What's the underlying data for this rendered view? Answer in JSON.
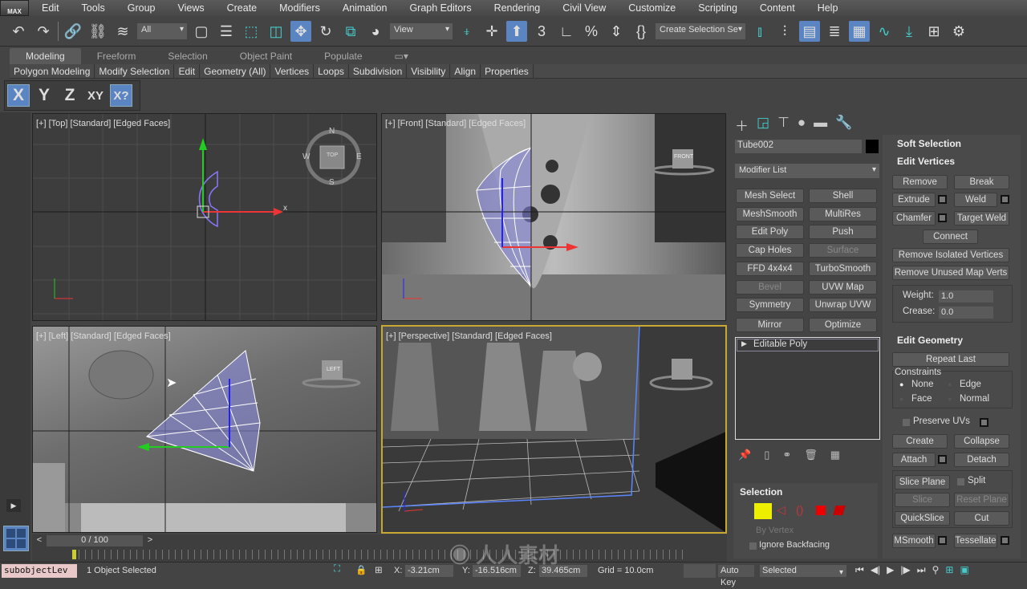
{
  "app": {
    "logo": "MAX"
  },
  "menu": [
    "Edit",
    "Tools",
    "Group",
    "Views",
    "Create",
    "Modifiers",
    "Animation",
    "Graph Editors",
    "Rendering",
    "Civil View",
    "Customize",
    "Scripting",
    "Content",
    "Help"
  ],
  "toolbar": {
    "filter": "All",
    "refcoord": "View",
    "selection_set": "Create Selection Se"
  },
  "ribbon": {
    "tabs": [
      "Modeling",
      "Freeform",
      "Selection",
      "Object Paint",
      "Populate"
    ],
    "active_tab": "Modeling",
    "panels": [
      "Polygon Modeling",
      "Modify Selection",
      "Edit",
      "Geometry (All)",
      "Vertices",
      "Loops",
      "Subdivision",
      "Visibility",
      "Align",
      "Properties"
    ]
  },
  "axis": {
    "x": "X",
    "y": "Y",
    "z": "Z",
    "xy": "XY",
    "xyq": "X?",
    "active": "X"
  },
  "viewports": {
    "top": "[+] [Top] [Standard] [Edged Faces]",
    "front": "[+] [Front] [Standard] [Edged Faces]",
    "left": "[+] [Left] [Standard] [Edged Faces]",
    "persp": "[+] [Perspective] [Standard] [Edged Faces]",
    "cube_top": "TOP",
    "cube_front": "FRONT",
    "cube_left": "LEFT",
    "compass": {
      "n": "N",
      "s": "S",
      "e": "E",
      "w": "W"
    },
    "axis_x": "x",
    "axis_y": "y",
    "axis_z": "z"
  },
  "command": {
    "object_name": "Tube002",
    "object_color": "#000000",
    "modifier_list": "Modifier List",
    "modifier_buttons": [
      "Mesh Select",
      "Shell",
      "MeshSmooth",
      "MultiRes",
      "Edit Poly",
      "Push",
      "Cap Holes",
      "Surface",
      "FFD 4x4x4",
      "TurboSmooth",
      "Bevel",
      "UVW Map",
      "Symmetry",
      "Unwrap UVW",
      "Mirror",
      "Optimize"
    ],
    "stack": [
      "Editable Poly"
    ],
    "selection": {
      "title": "Selection",
      "by_vertex": "By Vertex",
      "ignore_backfacing": "Ignore Backfacing"
    },
    "soft_selection": "Soft Selection",
    "edit_vertices": {
      "title": "Edit Vertices",
      "remove": "Remove",
      "break": "Break",
      "extrude": "Extrude",
      "weld": "Weld",
      "chamfer": "Chamfer",
      "target_weld": "Target Weld",
      "connect": "Connect",
      "remove_isolated": "Remove Isolated Vertices",
      "remove_unused": "Remove Unused Map Verts",
      "weight_label": "Weight:",
      "weight": "1.0",
      "crease_label": "Crease:",
      "crease": "0.0"
    },
    "edit_geometry": {
      "title": "Edit Geometry",
      "repeat_last": "Repeat Last",
      "constraints": "Constraints",
      "none": "None",
      "edge": "Edge",
      "face": "Face",
      "normal": "Normal",
      "preserve_uvs": "Preserve UVs",
      "create": "Create",
      "collapse": "Collapse",
      "attach": "Attach",
      "detach": "Detach",
      "slice_plane": "Slice Plane",
      "split": "Split",
      "slice": "Slice",
      "reset_plane": "Reset Plane",
      "quickslice": "QuickSlice",
      "cut": "Cut",
      "msmooth": "MSmooth",
      "tessellate": "Tessellate"
    }
  },
  "timeline": {
    "frame": "0 / 100",
    "prev": "<",
    "next": ">"
  },
  "status": {
    "script": "subobjectLev",
    "selected": "1 Object Selected",
    "x_label": "X:",
    "x": "-3.21cm",
    "y_label": "Y:",
    "y": "-16.516cm",
    "z_label": "Z:",
    "z": "39.465cm",
    "grid": "Grid = 10.0cm",
    "autokey": "Auto Key",
    "key_filter": "Selected"
  },
  "watermark": "人人素材"
}
